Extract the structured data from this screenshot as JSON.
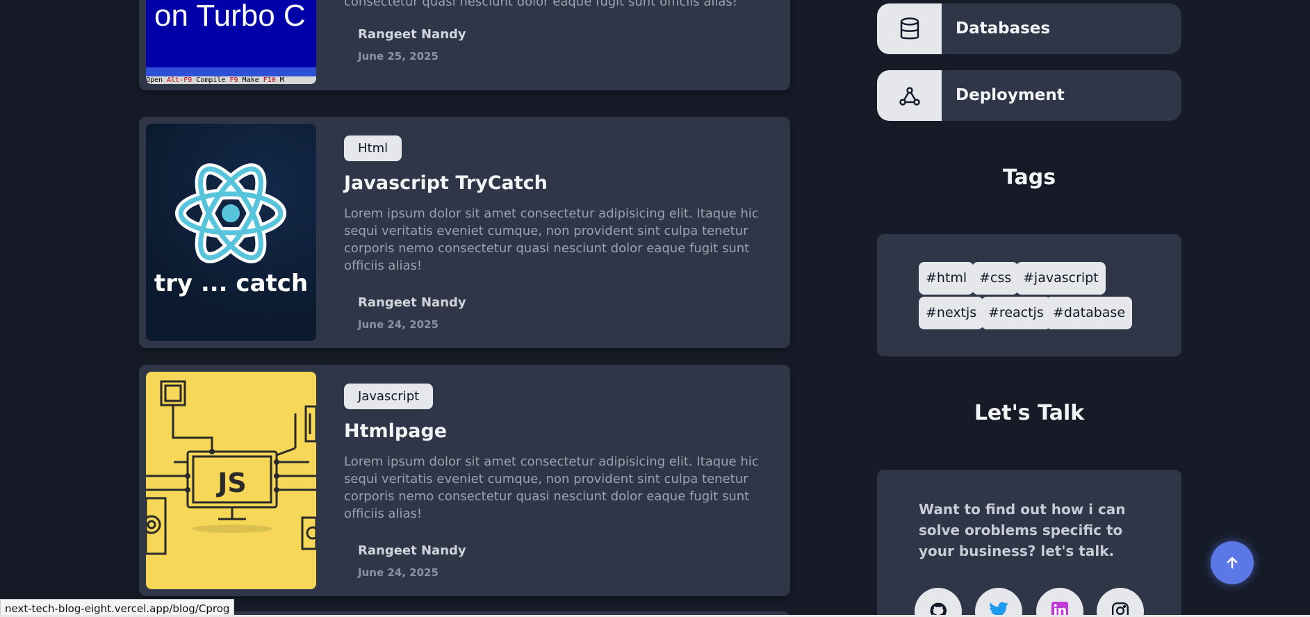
{
  "posts": [
    {
      "excerpt_tail": "consectetur quasi nesciunt dolor eaque fugit sunt officiis alias!",
      "author": "Rangeet Nandy",
      "date": "June 25, 2025",
      "thumb_text": "on Turbo C",
      "thumb_menu": [
        "Open",
        "Alt-F9",
        "Compile",
        "F9",
        "Make",
        "F10",
        "M"
      ]
    },
    {
      "category": "Html",
      "title": "Javascript TryCatch",
      "excerpt": "Lorem ipsum dolor sit amet consectetur adipisicing elit. Itaque hic sequi veritatis eveniet cumque, non provident sint culpa tenetur corporis nemo consectetur quasi nesciunt dolor eaque fugit sunt officiis alias!",
      "author": "Rangeet Nandy",
      "date": "June 24, 2025",
      "thumb_text": "try ... catch"
    },
    {
      "category": "Javascript",
      "title": "Htmlpage",
      "excerpt": "Lorem ipsum dolor sit amet consectetur adipisicing elit. Itaque hic sequi veritatis eveniet cumque, non provident sint culpa tenetur corporis nemo consectetur quasi nesciunt dolor eaque fugit sunt officiis alias!",
      "author": "Rangeet Nandy",
      "date": "June 24, 2025",
      "thumb_text": "JS"
    }
  ],
  "sidebar": {
    "categories": [
      {
        "label": "Databases",
        "icon": "database-icon"
      },
      {
        "label": "Deployment",
        "icon": "deployment-icon"
      }
    ],
    "tags_heading": "Tags",
    "tags": [
      "#html",
      "#css",
      "#javascript",
      "#nextjs",
      "#reactjs",
      "#database"
    ],
    "talk_heading": "Let's Talk",
    "talk_text": "Want to find out how i can solve oroblems specific to your business? let's talk.",
    "socials": [
      "github-icon",
      "twitter-icon",
      "linkedin-icon",
      "instagram-icon"
    ]
  },
  "status_bar_url": "next-tech-blog-eight.vercel.app/blog/Cprog",
  "colors": {
    "background": "#161b27",
    "card": "#2f3647",
    "badge": "#e5e7eb",
    "accent_button": "#5b78e6"
  }
}
